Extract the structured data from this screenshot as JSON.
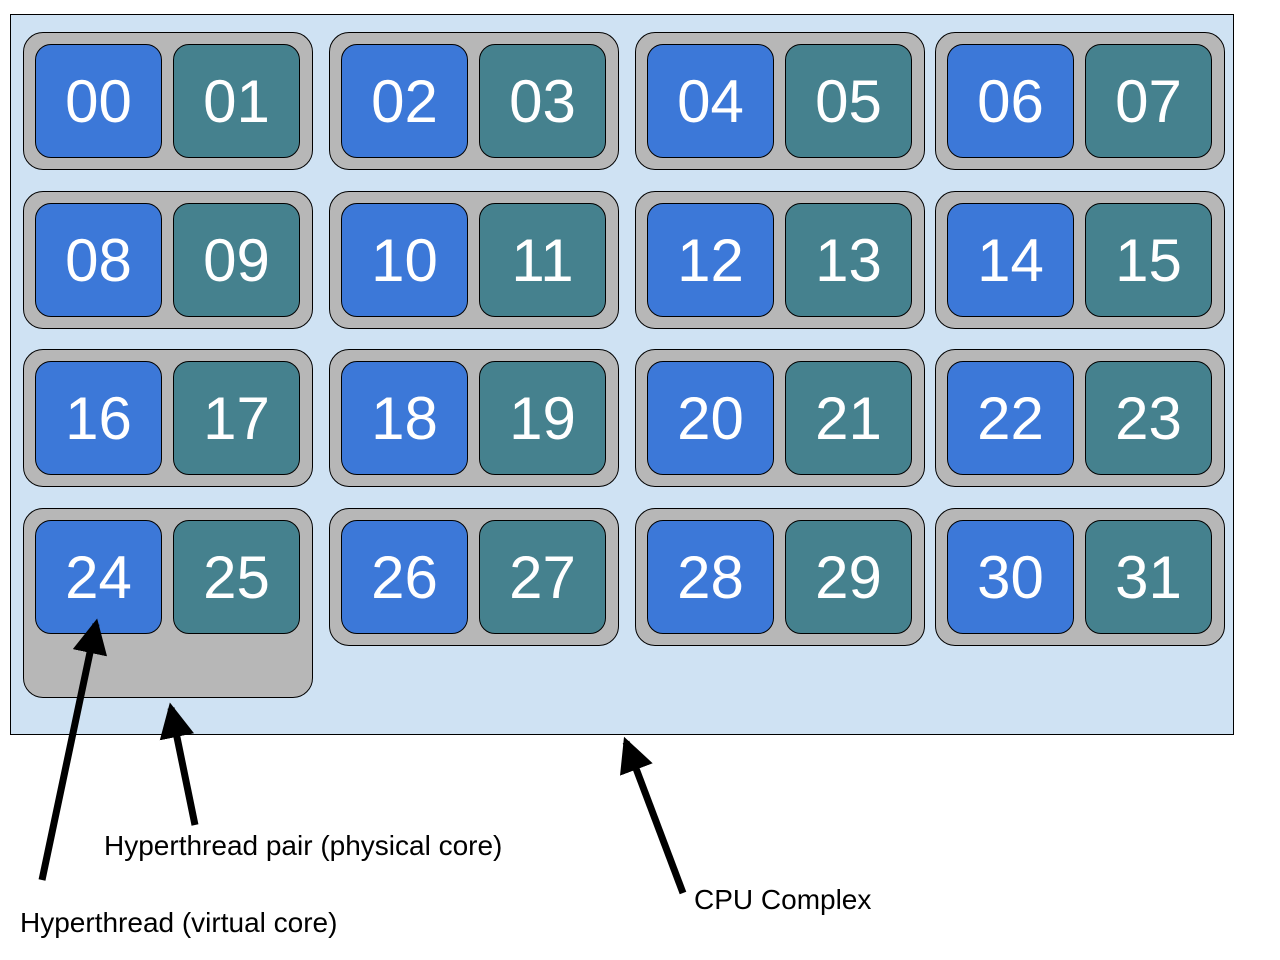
{
  "pairs": [
    {
      "threads": [
        "00",
        "01"
      ]
    },
    {
      "threads": [
        "02",
        "03"
      ]
    },
    {
      "threads": [
        "04",
        "05"
      ]
    },
    {
      "threads": [
        "06",
        "07"
      ]
    },
    {
      "threads": [
        "08",
        "09"
      ]
    },
    {
      "threads": [
        "10",
        "11"
      ]
    },
    {
      "threads": [
        "12",
        "13"
      ]
    },
    {
      "threads": [
        "14",
        "15"
      ]
    },
    {
      "threads": [
        "16",
        "17"
      ]
    },
    {
      "threads": [
        "18",
        "19"
      ]
    },
    {
      "threads": [
        "20",
        "21"
      ]
    },
    {
      "threads": [
        "22",
        "23"
      ]
    },
    {
      "threads": [
        "24",
        "25"
      ]
    },
    {
      "threads": [
        "26",
        "27"
      ]
    },
    {
      "threads": [
        "28",
        "29"
      ]
    },
    {
      "threads": [
        "30",
        "31"
      ]
    }
  ],
  "labels": {
    "hyperthread_pair": "Hyperthread pair (physical core)",
    "hyperthread": "Hyperthread (virtual core)",
    "cpu_complex": "CPU Complex"
  },
  "colors": {
    "complex_fill": "#cfe2f3",
    "pair_fill": "#b7b7b7",
    "virtual_thread_fill": "#3c78d8",
    "sibling_thread_fill": "#45818e",
    "text": "#ffffff",
    "arrow": "#000000"
  }
}
